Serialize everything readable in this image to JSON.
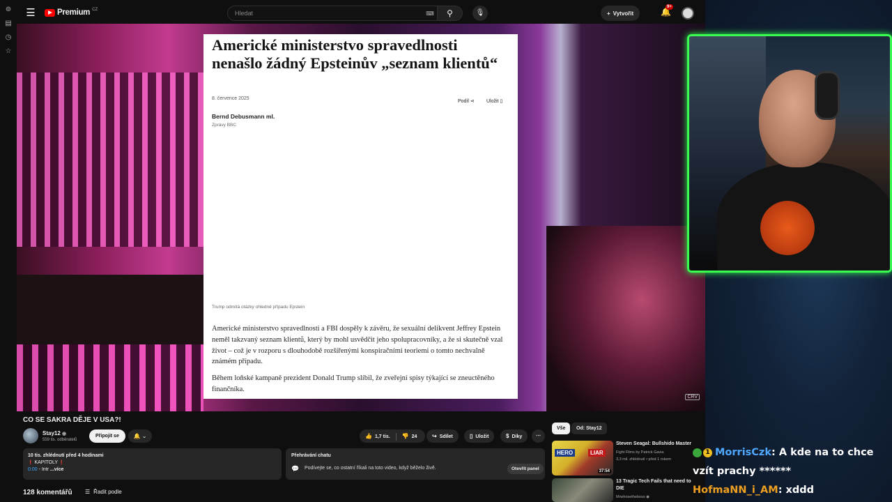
{
  "header": {
    "brand": "Premium",
    "country": "CZ",
    "search_placeholder": "Hledat",
    "create_label": "Vytvořit",
    "notif_count": "9+"
  },
  "article": {
    "headline": "Americké ministerstvo spravedlnosti nenašlo žádný Epsteinův „seznam klientů“",
    "date": "8. července 2025",
    "share": "Podíl",
    "save": "Uložit",
    "author": "Bernd Debusmann ml.",
    "source": "Zprávy BBC",
    "caption": "Trump odmítá otázky ohledně případu Epstein",
    "paragraph1": "Americké ministerstvo spravedlnosti a FBI dospěly k závěru, že sexuální delikvent Jeffrey Epstein neměl takzvaný seznam klientů, který by mohl usvědčit jeho spolupracovníky, a že si skutečně vzal život – což je v rozporu s dlouhodobě rozšířenými konspiračními teoriemi o tomto nechvalně známém případu.",
    "paragraph2": "Během loňské kampaně prezident Donald Trump slíbil, že zveřejní spisy týkající se zneuctěného finančníka."
  },
  "player": {
    "badge": "CRV"
  },
  "video": {
    "title": "CO SE SAKRA DĚJE V USA?!",
    "channel": "Stay12",
    "subscribers": "559 tis. odběratelů",
    "join": "Připojit se",
    "likes": "1,7 tis.",
    "dislikes": "24",
    "share": "Sdílet",
    "save": "Uložit",
    "thanks": "Díky"
  },
  "description": {
    "stats": "10 tis. zhlédnutí  před 4 hodinami",
    "chapters": "KAPITOLY",
    "time": "0:00",
    "intro": "- Intr",
    "more": "...více"
  },
  "chat_replay": {
    "header": "Přehrávání chatu",
    "text": "Podívejte se, co ostatní říkali na toto video, když běželo živě.",
    "open": "Otevřít panel"
  },
  "comments": {
    "count": "128 komentářů",
    "sort": "Řadit podle"
  },
  "chips": {
    "all": "Vše",
    "from": "Od: Stay12"
  },
  "recommendations": [
    {
      "title": "Steven Seagal: Bullshido Master",
      "channel": "Fight Films by Patrick Gavia",
      "meta": "3,3 mil. zhlédnutí • před 1 rokem",
      "duration": "37:54",
      "thumb_left": "HERO",
      "thumb_right": "LIAR"
    },
    {
      "title": "13 Tragic Tech Fails that need to DIE",
      "channel": "Mrwhosetheboss"
    }
  ],
  "live_chat": [
    {
      "user": "MorrisCzk",
      "message": ": A kde na to chce vzít prachy ******",
      "badge": "1"
    },
    {
      "user": "HofmaNN_i_AM",
      "message": ": xddd"
    }
  ],
  "colors": {
    "cam_border": "#3aff52",
    "accent_red": "#ff0000",
    "user1": "#4fa8ff",
    "user2": "#f0a020"
  }
}
